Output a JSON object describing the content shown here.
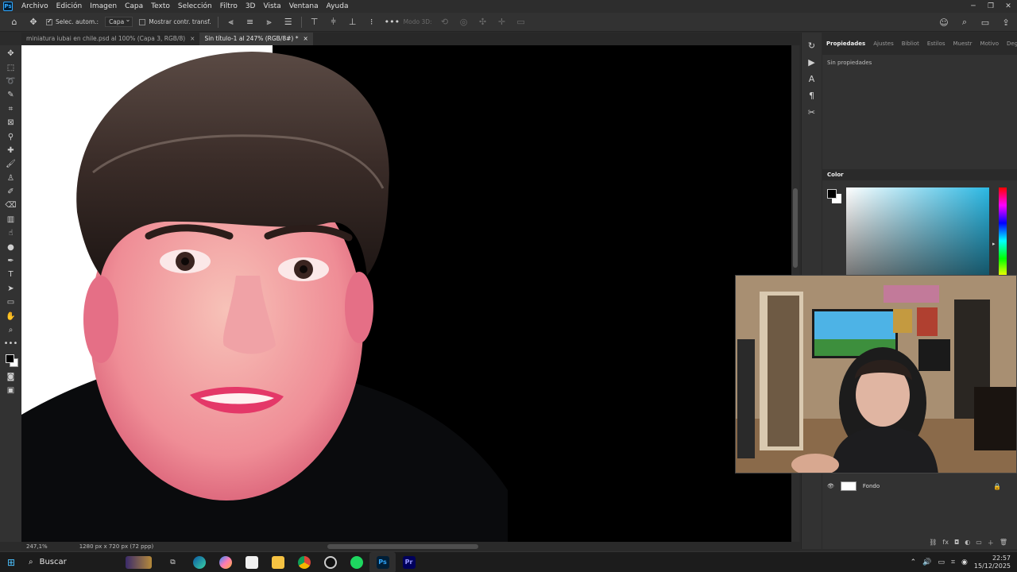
{
  "menubar": {
    "app_logo": "Ps",
    "items": [
      "Archivo",
      "Edición",
      "Imagen",
      "Capa",
      "Texto",
      "Selección",
      "Filtro",
      "3D",
      "Vista",
      "Ventana",
      "Ayuda"
    ]
  },
  "options_bar": {
    "auto_select_label": "Selec. autom.:",
    "auto_select_value": "Capa",
    "transform_label": "Mostrar contr. transf.",
    "mode_3d_label": "Modo 3D:"
  },
  "doc_tabs": [
    {
      "label": "miniatura iubai en chile.psd al 100% (Capa 3, RGB/8)",
      "close": "×"
    },
    {
      "label": "Sin título-1 al 247% (RGB/8#) *",
      "close": "×"
    }
  ],
  "status_bar": {
    "zoom": "247,1%",
    "doc_info": "1280 px x 720 px (72 ppp)"
  },
  "panels": {
    "tabs": [
      "Propiedades",
      "Ajustes",
      "Bibliot",
      "Estilos",
      "Muestr",
      "Motivo",
      "Degrad"
    ],
    "properties_text": "Sin propiedades",
    "color_title": "Color",
    "color_accent": "#2bb8e3"
  },
  "layers": {
    "layer_name": "Fondo"
  },
  "taskbar": {
    "search_label": "Buscar",
    "time": "22:57",
    "date": "15/12/2025"
  }
}
